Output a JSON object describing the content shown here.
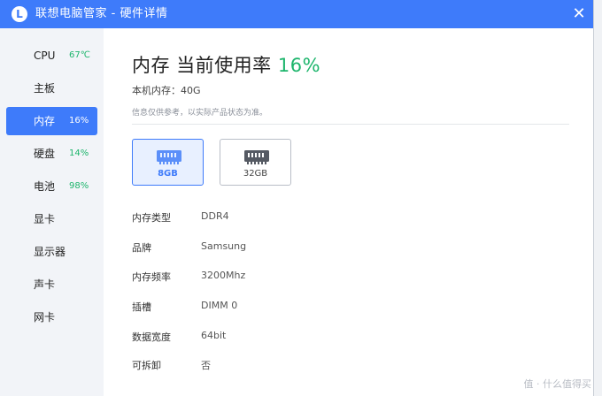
{
  "window": {
    "title": "联想电脑管家 - 硬件详情",
    "logo_letter": "L",
    "close_glyph": "✕"
  },
  "sidebar": {
    "items": [
      {
        "label": "CPU",
        "value": "67℃"
      },
      {
        "label": "主板",
        "value": ""
      },
      {
        "label": "内存",
        "value": "16%"
      },
      {
        "label": "硬盘",
        "value": "14%"
      },
      {
        "label": "电池",
        "value": "98%"
      },
      {
        "label": "显卡",
        "value": ""
      },
      {
        "label": "显示器",
        "value": ""
      },
      {
        "label": "声卡",
        "value": ""
      },
      {
        "label": "网卡",
        "value": ""
      }
    ],
    "active_index": 2,
    "accent": "#3e7bfa",
    "status_color": "#1db56c"
  },
  "main": {
    "heading_text": "内存 当前使用率",
    "heading_pct": "16%",
    "total_memory": "本机内存：40G",
    "note": "信息仅供参考，以实际产品状态为准。",
    "modules": [
      {
        "label": "8GB",
        "selected": true,
        "icon": "memory-chip-icon"
      },
      {
        "label": "32GB",
        "selected": false,
        "icon": "memory-chip-icon"
      }
    ],
    "specs": [
      {
        "key": "内存类型",
        "value": "DDR4"
      },
      {
        "key": "品牌",
        "value": "Samsung"
      },
      {
        "key": "内存频率",
        "value": "3200Mhz"
      },
      {
        "key": "插槽",
        "value": "DIMM 0"
      },
      {
        "key": "数据宽度",
        "value": "64bit"
      },
      {
        "key": "可拆卸",
        "value": "否"
      }
    ]
  },
  "watermark": "值 · 什么值得买"
}
